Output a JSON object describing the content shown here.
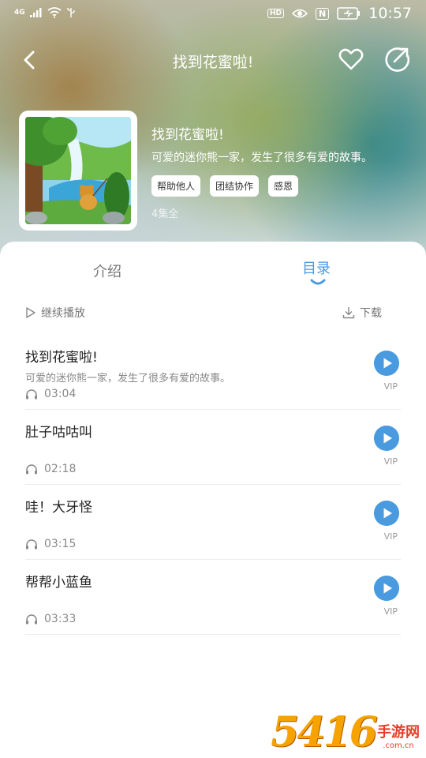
{
  "status_bar": {
    "network": "4G",
    "time": "10:57",
    "hd_label": "HD",
    "nfc_label": "N"
  },
  "nav": {
    "title": "找到花蜜啦!"
  },
  "album": {
    "title": "找到花蜜啦!",
    "description": "可爱的迷你熊一家，发生了很多有爱的故事。",
    "tags": [
      "帮助他人",
      "团结协作",
      "感恩"
    ],
    "episode_count": "4集全"
  },
  "tabs": {
    "intro": "介绍",
    "catalog": "目录",
    "active": "catalog"
  },
  "toolbar": {
    "continue_label": "继续播放",
    "download_label": "下载"
  },
  "episodes": [
    {
      "title": "找到花蜜啦!",
      "description": "可爱的迷你熊一家，发生了很多有爱的故事。",
      "duration": "03:04",
      "badge": "VIP"
    },
    {
      "title": "肚子咕咕叫",
      "description": "",
      "duration": "02:18",
      "badge": "VIP"
    },
    {
      "title": "哇！大牙怪",
      "description": "",
      "duration": "03:15",
      "badge": "VIP"
    },
    {
      "title": "帮帮小蓝鱼",
      "description": "",
      "duration": "03:33",
      "badge": "VIP"
    }
  ],
  "watermark": {
    "number": "5416",
    "text": "手游网",
    "url": ".com.cn"
  },
  "colors": {
    "accent": "#4a9ae0",
    "watermark_orange": "#f6a300",
    "watermark_red": "#e53c24"
  }
}
